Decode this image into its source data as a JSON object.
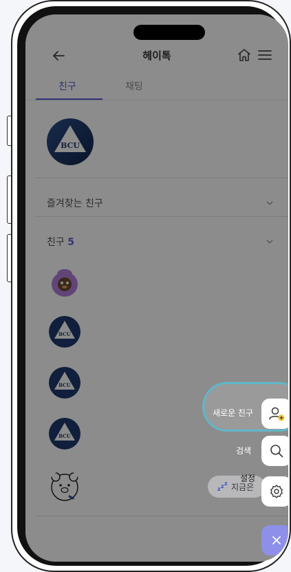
{
  "header": {
    "title": "헤이톡",
    "back_icon": "arrow-left-icon",
    "home_icon": "home-icon",
    "menu_icon": "hamburger-menu-icon"
  },
  "tabs": [
    {
      "label": "친구",
      "active": true
    },
    {
      "label": "채팅",
      "active": false
    }
  ],
  "profile": {
    "badge_text": "BCU"
  },
  "sections": {
    "favorites": {
      "label": "즐겨찾는 친구"
    },
    "friends": {
      "label": "친구",
      "count": "5"
    }
  },
  "friends": [
    {
      "avatar": "purple-character-avatar"
    },
    {
      "avatar": "BCU"
    },
    {
      "avatar": "BCU"
    },
    {
      "avatar": "BCU"
    },
    {
      "avatar": "bear-character-avatar"
    }
  ],
  "fab_menu": {
    "new_friend_label": "새로운 친구",
    "search_label": "검색",
    "settings_label": "설정",
    "now_label": "지금은"
  },
  "colors": {
    "accent": "#5a5fd6",
    "fab_close": "#8d8fe8",
    "highlight_ring": "#5fb7c9",
    "badge_navy": "#1e3a6e"
  }
}
